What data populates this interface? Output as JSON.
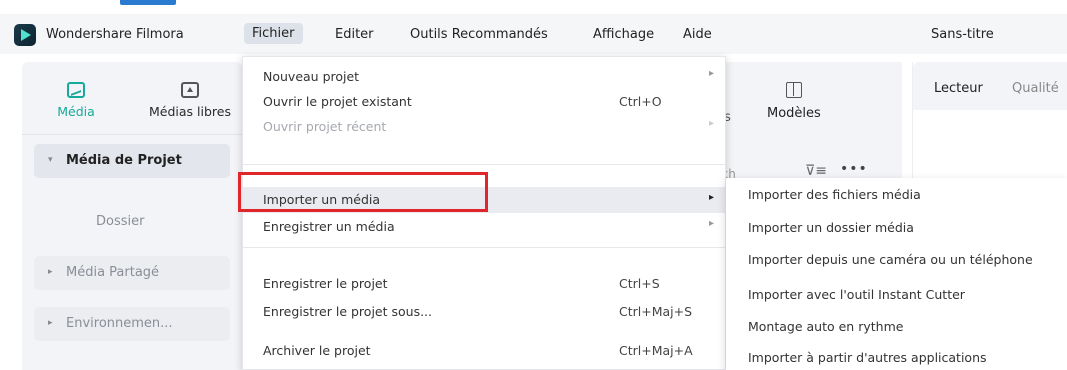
{
  "menubar": {
    "app_name": "Wondershare Filmora",
    "items": [
      "Fichier",
      "Editer",
      "Outils Recommandés",
      "Affichage",
      "Aide"
    ],
    "document_title": "Sans-titre"
  },
  "left_panel": {
    "tools": [
      {
        "label": "Média",
        "icon": "image-icon",
        "active": true
      },
      {
        "label": "Médias libres",
        "icon": "cloud-library-icon",
        "active": false
      }
    ],
    "entries": [
      "Média de Projet",
      "Dossier",
      "Média Partagé",
      "Environnemen..."
    ]
  },
  "middle_panel": {
    "tool_label": "Modèles",
    "partial_tab": "ts",
    "partial_search": "rch"
  },
  "right_panel": {
    "tab_lecteur": "Lecteur",
    "tab_qualite": "Qualité"
  },
  "file_menu": {
    "items": [
      {
        "label": "Nouveau projet",
        "shortcut": "",
        "submenu": true,
        "disabled": false
      },
      {
        "label": "Ouvrir le projet existant",
        "shortcut": "Ctrl+O",
        "submenu": false,
        "disabled": false
      },
      {
        "label": "Ouvrir projet récent",
        "shortcut": "",
        "submenu": true,
        "disabled": true
      },
      {
        "label": "Importer un média",
        "shortcut": "",
        "submenu": true,
        "disabled": false,
        "highlighted": true
      },
      {
        "label": "Enregistrer un média",
        "shortcut": "",
        "submenu": true,
        "disabled": false
      },
      {
        "label": "Enregistrer le projet",
        "shortcut": "Ctrl+S",
        "submenu": false,
        "disabled": false
      },
      {
        "label": "Enregistrer le projet sous...",
        "shortcut": "Ctrl+Maj+S",
        "submenu": false,
        "disabled": false
      },
      {
        "label": "Archiver le projet",
        "shortcut": "Ctrl+Maj+A",
        "submenu": false,
        "disabled": false
      }
    ]
  },
  "import_submenu": {
    "items": [
      "Importer des fichiers média",
      "Importer un dossier média",
      "Importer depuis une caméra ou un téléphone",
      "Importer avec l'outil Instant Cutter",
      "Montage auto en rythme",
      "Importer à partir d'autres applications"
    ]
  },
  "colors": {
    "accent": "#17a99a",
    "highlight_box": "#e0262a",
    "menu_hover": "#e9ebf0"
  }
}
